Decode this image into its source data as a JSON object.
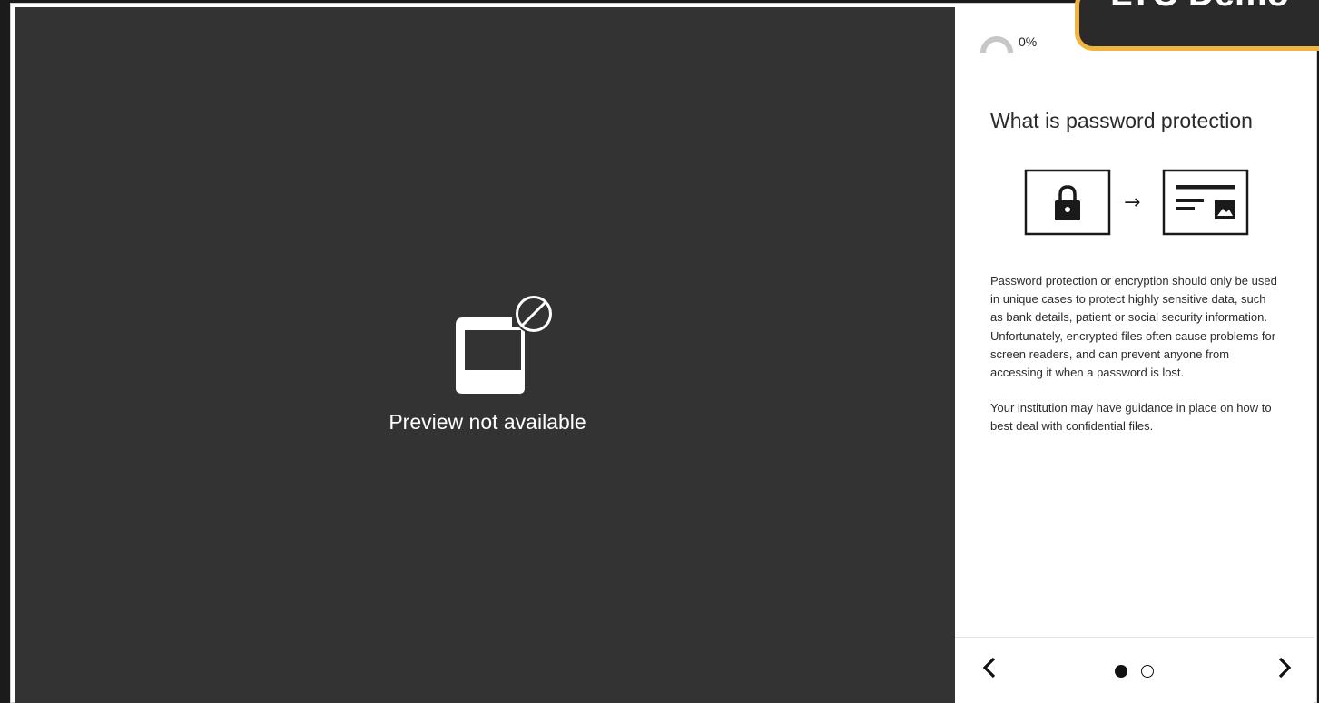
{
  "preview": {
    "message": "Preview not available",
    "icon": "file-blocked-icon"
  },
  "panel": {
    "progress": {
      "value": 0,
      "label": "0%"
    },
    "title": "What is password protection",
    "illustration": {
      "left_icon": "lock-icon",
      "arrow": "→",
      "right_icon": "document-icon"
    },
    "paragraphs": [
      "Password protection or encryption should only be used in unique cases to protect highly sensitive data, such as bank details, patient or social security information. Unfortunately, encrypted files often cause problems for screen readers, and can prevent anyone from accessing it when a password is lost.",
      "Your institution may have guidance in place on how to best deal with confidential files."
    ]
  },
  "pagination": {
    "prev_icon": "chevron-left-icon",
    "next_icon": "chevron-right-icon",
    "current_page": 1,
    "total_pages": 2
  },
  "promo": {
    "text": "LTC Demo"
  },
  "colors": {
    "preview_bg": "#333333",
    "accent_border": "#f2b441",
    "text_dark": "#2b2b2b"
  }
}
